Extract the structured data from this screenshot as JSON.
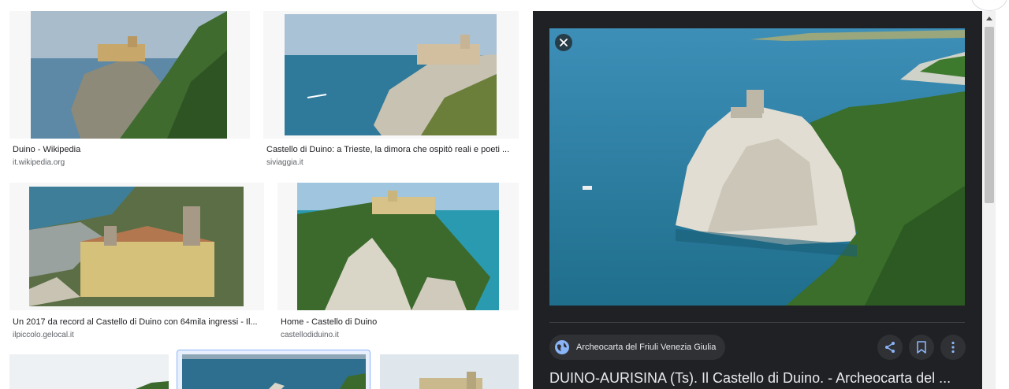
{
  "results": [
    {
      "title": "Duino - Wikipedia",
      "source": "it.wikipedia.org"
    },
    {
      "title": "Castello di Duino: a Trieste, la dimora che ospitò reali e poeti ...",
      "source": "siviaggia.it"
    },
    {
      "title": "Un 2017 da record al Castello di Duino con 64mila ingressi - Il...",
      "source": "ilpiccolo.gelocal.it"
    },
    {
      "title": "Home - Castello di Duino",
      "source": "castellodiduino.it"
    }
  ],
  "preview": {
    "source_name": "Archeocarta del Friuli Venezia Giulia",
    "title": "DUINO-AURISINA (Ts). Il Castello di Duino. - Archeocarta del ...",
    "icons": {
      "close": "close-icon",
      "globe": "globe-icon",
      "share": "share-icon",
      "save": "bookmark-icon",
      "more": "more-vert-icon"
    }
  },
  "colors": {
    "panel_bg": "#202124",
    "chip_bg": "#303134",
    "accent": "#8ab4f8",
    "text_primary": "#202124",
    "text_secondary": "#5f6368"
  }
}
